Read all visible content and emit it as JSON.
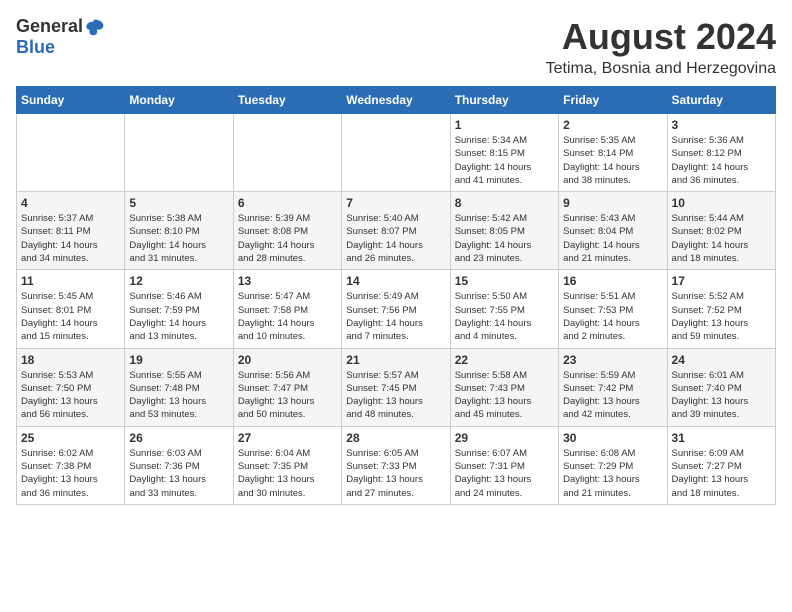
{
  "logo": {
    "general": "General",
    "blue": "Blue"
  },
  "title": {
    "month_year": "August 2024",
    "subtitle": "Tetima, Bosnia and Herzegovina"
  },
  "weekdays": [
    "Sunday",
    "Monday",
    "Tuesday",
    "Wednesday",
    "Thursday",
    "Friday",
    "Saturday"
  ],
  "weeks": [
    [
      {
        "day": "",
        "info": ""
      },
      {
        "day": "",
        "info": ""
      },
      {
        "day": "",
        "info": ""
      },
      {
        "day": "",
        "info": ""
      },
      {
        "day": "1",
        "info": "Sunrise: 5:34 AM\nSunset: 8:15 PM\nDaylight: 14 hours\nand 41 minutes."
      },
      {
        "day": "2",
        "info": "Sunrise: 5:35 AM\nSunset: 8:14 PM\nDaylight: 14 hours\nand 38 minutes."
      },
      {
        "day": "3",
        "info": "Sunrise: 5:36 AM\nSunset: 8:12 PM\nDaylight: 14 hours\nand 36 minutes."
      }
    ],
    [
      {
        "day": "4",
        "info": "Sunrise: 5:37 AM\nSunset: 8:11 PM\nDaylight: 14 hours\nand 34 minutes."
      },
      {
        "day": "5",
        "info": "Sunrise: 5:38 AM\nSunset: 8:10 PM\nDaylight: 14 hours\nand 31 minutes."
      },
      {
        "day": "6",
        "info": "Sunrise: 5:39 AM\nSunset: 8:08 PM\nDaylight: 14 hours\nand 28 minutes."
      },
      {
        "day": "7",
        "info": "Sunrise: 5:40 AM\nSunset: 8:07 PM\nDaylight: 14 hours\nand 26 minutes."
      },
      {
        "day": "8",
        "info": "Sunrise: 5:42 AM\nSunset: 8:05 PM\nDaylight: 14 hours\nand 23 minutes."
      },
      {
        "day": "9",
        "info": "Sunrise: 5:43 AM\nSunset: 8:04 PM\nDaylight: 14 hours\nand 21 minutes."
      },
      {
        "day": "10",
        "info": "Sunrise: 5:44 AM\nSunset: 8:02 PM\nDaylight: 14 hours\nand 18 minutes."
      }
    ],
    [
      {
        "day": "11",
        "info": "Sunrise: 5:45 AM\nSunset: 8:01 PM\nDaylight: 14 hours\nand 15 minutes."
      },
      {
        "day": "12",
        "info": "Sunrise: 5:46 AM\nSunset: 7:59 PM\nDaylight: 14 hours\nand 13 minutes."
      },
      {
        "day": "13",
        "info": "Sunrise: 5:47 AM\nSunset: 7:58 PM\nDaylight: 14 hours\nand 10 minutes."
      },
      {
        "day": "14",
        "info": "Sunrise: 5:49 AM\nSunset: 7:56 PM\nDaylight: 14 hours\nand 7 minutes."
      },
      {
        "day": "15",
        "info": "Sunrise: 5:50 AM\nSunset: 7:55 PM\nDaylight: 14 hours\nand 4 minutes."
      },
      {
        "day": "16",
        "info": "Sunrise: 5:51 AM\nSunset: 7:53 PM\nDaylight: 14 hours\nand 2 minutes."
      },
      {
        "day": "17",
        "info": "Sunrise: 5:52 AM\nSunset: 7:52 PM\nDaylight: 13 hours\nand 59 minutes."
      }
    ],
    [
      {
        "day": "18",
        "info": "Sunrise: 5:53 AM\nSunset: 7:50 PM\nDaylight: 13 hours\nand 56 minutes."
      },
      {
        "day": "19",
        "info": "Sunrise: 5:55 AM\nSunset: 7:48 PM\nDaylight: 13 hours\nand 53 minutes."
      },
      {
        "day": "20",
        "info": "Sunrise: 5:56 AM\nSunset: 7:47 PM\nDaylight: 13 hours\nand 50 minutes."
      },
      {
        "day": "21",
        "info": "Sunrise: 5:57 AM\nSunset: 7:45 PM\nDaylight: 13 hours\nand 48 minutes."
      },
      {
        "day": "22",
        "info": "Sunrise: 5:58 AM\nSunset: 7:43 PM\nDaylight: 13 hours\nand 45 minutes."
      },
      {
        "day": "23",
        "info": "Sunrise: 5:59 AM\nSunset: 7:42 PM\nDaylight: 13 hours\nand 42 minutes."
      },
      {
        "day": "24",
        "info": "Sunrise: 6:01 AM\nSunset: 7:40 PM\nDaylight: 13 hours\nand 39 minutes."
      }
    ],
    [
      {
        "day": "25",
        "info": "Sunrise: 6:02 AM\nSunset: 7:38 PM\nDaylight: 13 hours\nand 36 minutes."
      },
      {
        "day": "26",
        "info": "Sunrise: 6:03 AM\nSunset: 7:36 PM\nDaylight: 13 hours\nand 33 minutes."
      },
      {
        "day": "27",
        "info": "Sunrise: 6:04 AM\nSunset: 7:35 PM\nDaylight: 13 hours\nand 30 minutes."
      },
      {
        "day": "28",
        "info": "Sunrise: 6:05 AM\nSunset: 7:33 PM\nDaylight: 13 hours\nand 27 minutes."
      },
      {
        "day": "29",
        "info": "Sunrise: 6:07 AM\nSunset: 7:31 PM\nDaylight: 13 hours\nand 24 minutes."
      },
      {
        "day": "30",
        "info": "Sunrise: 6:08 AM\nSunset: 7:29 PM\nDaylight: 13 hours\nand 21 minutes."
      },
      {
        "day": "31",
        "info": "Sunrise: 6:09 AM\nSunset: 7:27 PM\nDaylight: 13 hours\nand 18 minutes."
      }
    ]
  ]
}
